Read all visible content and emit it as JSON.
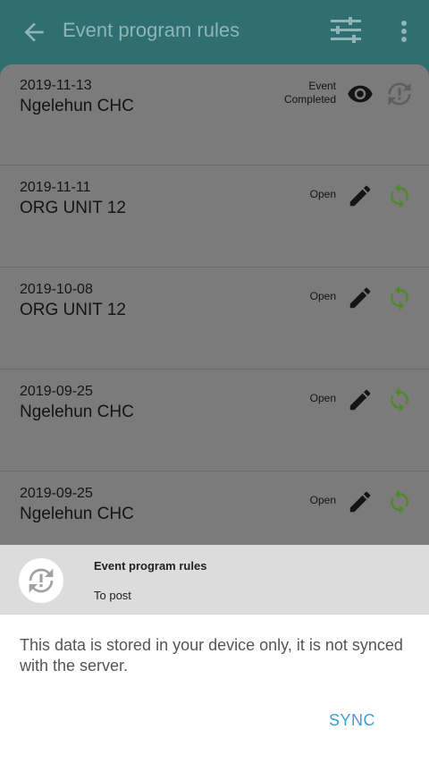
{
  "header": {
    "title": "Event program rules",
    "back_icon": "arrow-back-icon",
    "filter_icon": "filter-icon",
    "more_icon": "more-vert-icon"
  },
  "events": [
    {
      "date": "2019-11-13",
      "org_unit": "Ngelehun CHC",
      "status_line1": "Event",
      "status_line2": "Completed",
      "action_icon": "eye-icon",
      "sync_icon": "sync-error-icon"
    },
    {
      "date": "2019-11-11",
      "org_unit": "ORG UNIT 12",
      "status_line1": "Open",
      "status_line2": "",
      "action_icon": "edit-icon",
      "sync_icon": "sync-icon"
    },
    {
      "date": "2019-10-08",
      "org_unit": "ORG UNIT 12",
      "status_line1": "Open",
      "status_line2": "",
      "action_icon": "edit-icon",
      "sync_icon": "sync-icon"
    },
    {
      "date": "2019-09-25",
      "org_unit": "Ngelehun CHC",
      "status_line1": "Open",
      "status_line2": "",
      "action_icon": "edit-icon",
      "sync_icon": "sync-icon"
    },
    {
      "date": "2019-09-25",
      "org_unit": "Ngelehun CHC",
      "status_line1": "Open",
      "status_line2": "",
      "action_icon": "edit-icon",
      "sync_icon": "sync-icon"
    }
  ],
  "sheet": {
    "title": "Event program rules",
    "subtitle": "To post",
    "message": "This data is stored in your device only, it is not synced with the server.",
    "sync_label": "SYNC"
  },
  "colors": {
    "header": "#2f6e71",
    "sync_green": "#4f8a2a",
    "sync_link": "#3aa1d3"
  }
}
